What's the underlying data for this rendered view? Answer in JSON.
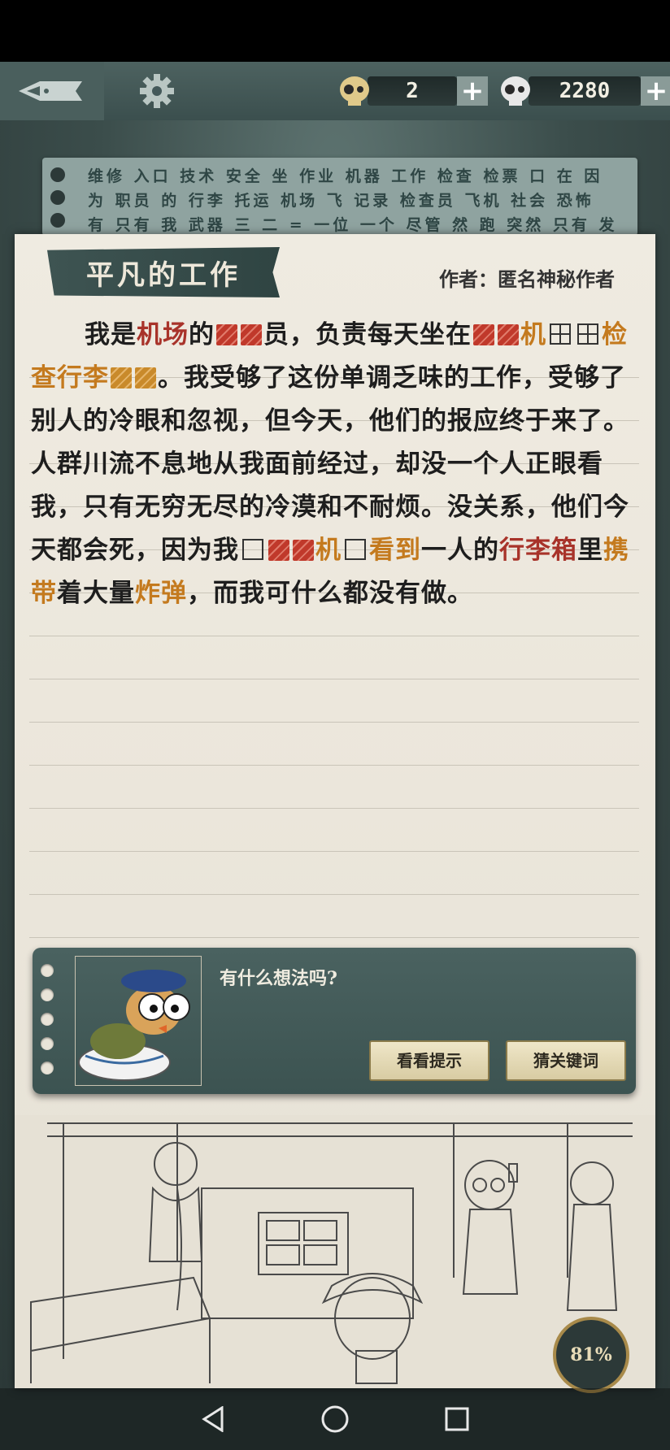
{
  "currencies": {
    "hints": "2",
    "coins": "2280",
    "add_symbol": "+"
  },
  "background_note": {
    "text": "维修 入口 技术 安全 坐 作业 机器 工作 检查 检票 口 在 因为 职员 的 行李 托运 机场 飞 记录 检查员 飞机 社会 恐怖 有 只有 我 武器 三 二 = 一位 一个 尽管 然 跑 突然 只有 发现 今天 背"
  },
  "story": {
    "title": "平凡的工作",
    "author_label": "作者：",
    "author": "匿名神秘作者",
    "segments": {
      "s1": "我是",
      "k1": "机场",
      "s2": "的",
      "s3": "员，负责每天坐在",
      "k2": "机",
      "k3": "检查行李",
      "s4": "。我受够了这份单调乏味的工作，受够了别人的冷眼和忽视，但今天，他们的报应终于来了。人群川流不息地从我面前经过，却没一个人正眼看我，只有无穷无尽的冷漠和不耐烦。没关系，他们今天都会死，因为我",
      "k4": "机",
      "k5": "看到",
      "s5": "一人的",
      "k6": "行李箱",
      "s6": "里",
      "k7": "携带",
      "s7": "着大量",
      "k8": "炸弹",
      "s8": "，而我可什么都没有做。"
    }
  },
  "dialog": {
    "prompt": "有什么想法吗?",
    "hint_button": "看看提示",
    "guess_button": "猜关键词"
  },
  "progress": "81%",
  "colors": {
    "keyword_red": "#a8332a",
    "keyword_orange": "#c47a1e",
    "board": "#3b4f4e",
    "paper": "#ece7dc"
  },
  "icons": [
    "pen-icon",
    "gear-icon",
    "skull-hint-icon",
    "skull-coin-icon",
    "back-icon",
    "home-icon",
    "recents-icon"
  ]
}
